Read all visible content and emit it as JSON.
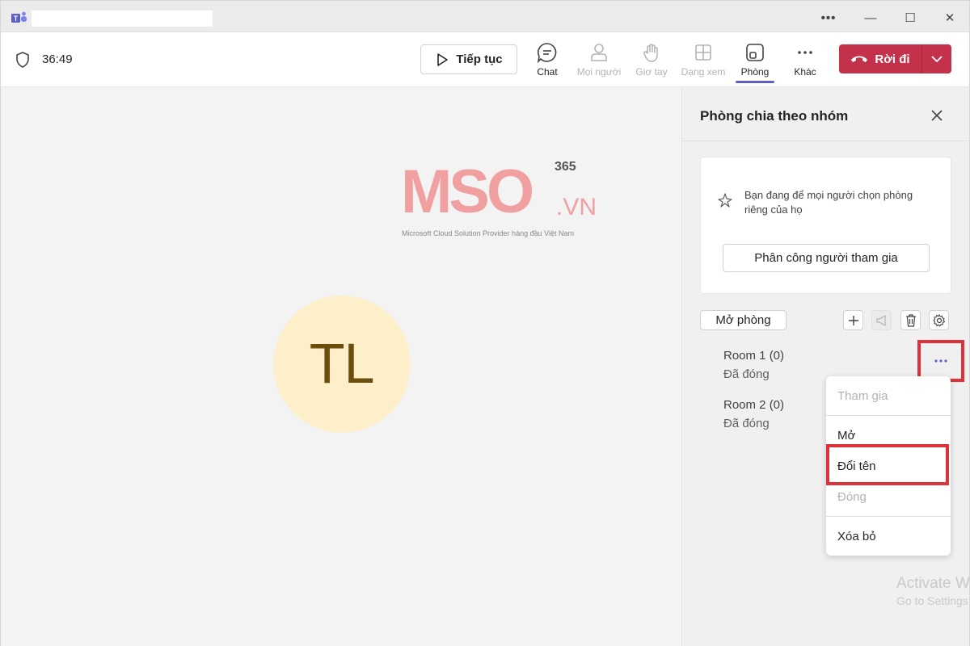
{
  "window": {
    "title_text": "",
    "controls": {
      "more": "•••",
      "minimize": "—",
      "maximize": "☐",
      "close": "✕"
    }
  },
  "toolbar": {
    "timer": "36:49",
    "resume_label": "Tiếp tục",
    "tools": {
      "chat": "Chat",
      "people": "Mọi người",
      "raise_hand": "Giơ tay",
      "view": "Dạng xem",
      "rooms": "Phòng",
      "more": "Khác"
    },
    "leave_label": "Rời đi",
    "leave_color": "#c4314b",
    "accent_color": "#5b5fc7"
  },
  "stage": {
    "watermark": {
      "logo": "MSO",
      "superscript": "365",
      "suffix": ".VN",
      "tagline": "Microsoft Cloud Solution Provider hàng đầu Việt Nam"
    },
    "avatar_initials": "TL",
    "avatar_bg": "#fdefc9"
  },
  "panel": {
    "title": "Phòng chia theo nhóm",
    "info_text": "Bạn đang để mọi người chọn phòng riêng của họ",
    "assign_label": "Phân công người tham gia",
    "open_rooms_label": "Mở phòng",
    "rooms": [
      {
        "name": "Room 1  (0)",
        "status": "Đã đóng"
      },
      {
        "name": "Room 2  (0)",
        "status": "Đã đóng"
      }
    ],
    "more_label": "•••"
  },
  "context_menu": {
    "join": "Tham gia",
    "open": "Mở",
    "rename": "Đổi tên",
    "close": "Đóng",
    "delete": "Xóa bỏ"
  },
  "system": {
    "activate_line1": "Activate W",
    "activate_line2": "Go to Settings"
  },
  "highlight_color": "#e0303a"
}
